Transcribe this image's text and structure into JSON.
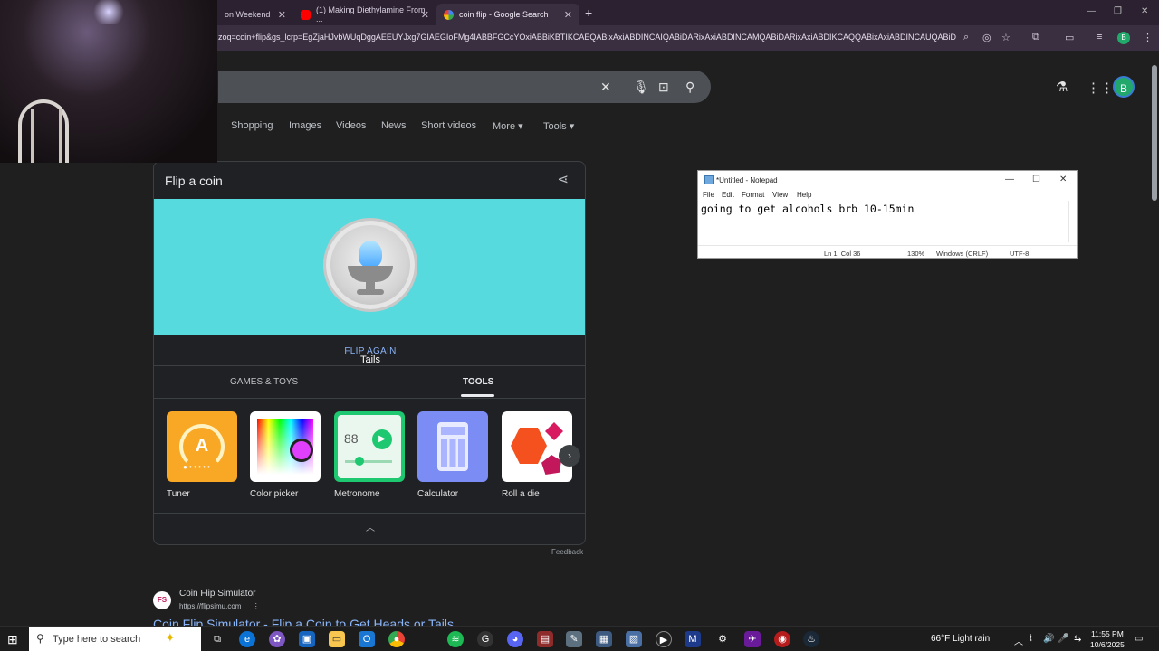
{
  "browser": {
    "tabs": [
      {
        "label": "on Weekend"
      },
      {
        "label": "(1) Making Diethylamine From ..."
      },
      {
        "label": "coin flip - Google Search"
      }
    ],
    "url": "zoq=coin+flip&gs_lcrp=EgZjaHJvbWUqDggAEEUYJxg7GIAEGIoFMg4IABBFGCcYOxiABBiKBTIKCAEQABixAxiABDINCAIQABiDARixAxiABDINCAMQABiDARixAxiABDIKCAQQABixAxiABDINCAUQABiDAR..."
  },
  "search": {
    "nav": [
      "Shopping",
      "Images",
      "Videos",
      "News",
      "Short videos",
      "More",
      "Tools"
    ]
  },
  "coin_card": {
    "title": "Flip a coin",
    "result": "Tails",
    "flip_again": "FLIP AGAIN",
    "categories": [
      "GAMES & TOYS",
      "TOOLS"
    ],
    "tools": [
      "Tuner",
      "Color picker",
      "Metronome",
      "Calculator",
      "Roll a die"
    ],
    "metronome_value": "88",
    "accent": "#57dade"
  },
  "feedback": "Feedback",
  "result": {
    "favicon": "FS",
    "site": "Coin Flip Simulator",
    "url": "https://flipsimu.com",
    "title": "Coin Flip Simulator - Flip a Coin to Get Heads or Tails"
  },
  "notepad": {
    "title": "*Untitled - Notepad",
    "menu": [
      "File",
      "Edit",
      "Format",
      "View",
      "Help"
    ],
    "text": "going to get alcohols brb 10-15min",
    "status": [
      "Ln 1, Col 36",
      "130%",
      "Windows (CRLF)",
      "UTF-8"
    ]
  },
  "taskbar": {
    "search_placeholder": "Type here to search",
    "weather": "66°F  Light rain",
    "time": "11:55 PM",
    "date": "10/6/2025"
  }
}
